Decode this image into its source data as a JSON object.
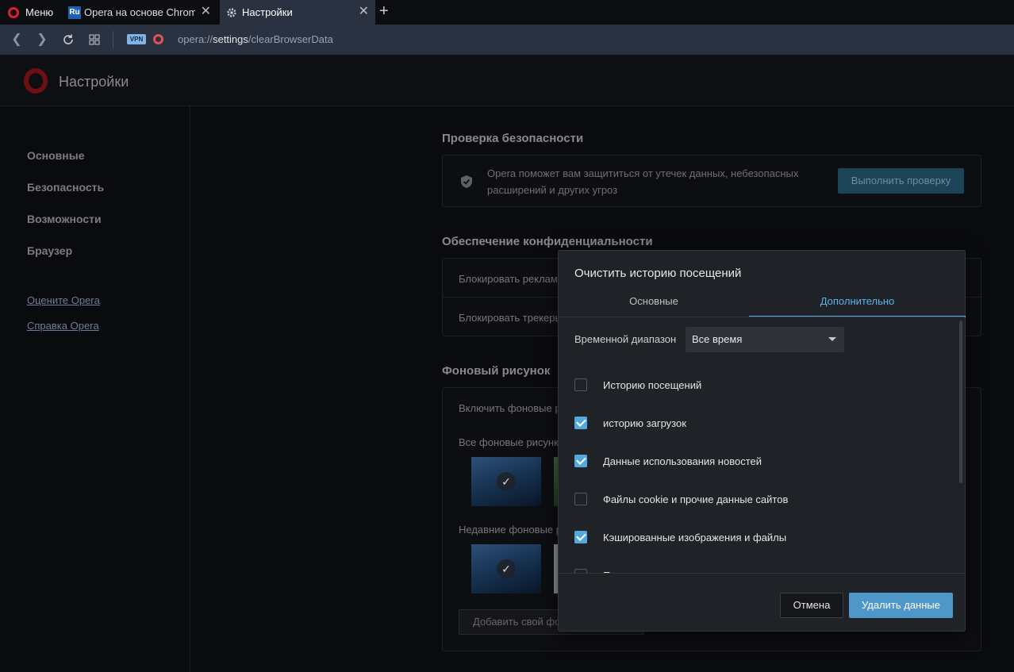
{
  "browser": {
    "menu_label": "Меню",
    "tabs": [
      {
        "label": "Opera на основе Chromium",
        "icon": "Ru"
      },
      {
        "label": "Настройки",
        "icon": "gear-icon"
      }
    ],
    "url_prefix": "opera://",
    "url_host": "settings",
    "url_path": "/clearBrowserData",
    "vpn_label": "VPN"
  },
  "header": {
    "title": "Настройки"
  },
  "sidebar": {
    "items": [
      {
        "label": "Основные"
      },
      {
        "label": "Безопасность"
      },
      {
        "label": "Возможности"
      },
      {
        "label": "Браузер"
      }
    ],
    "links": [
      {
        "label": "Оцените Opera"
      },
      {
        "label": "Справка Opera"
      }
    ]
  },
  "main": {
    "security": {
      "title": "Проверка безопасности",
      "text_line1": "Opera поможет вам защититься от утечек данных, небезопасных",
      "text_line2": "расширений и других угроз",
      "button": "Выполнить проверку"
    },
    "privacy": {
      "title": "Обеспечение конфиденциальности",
      "rows": [
        "Блокировать рекламу",
        "Блокировать трекеры"
      ]
    },
    "wallpaper": {
      "title": "Фоновый рисунок",
      "enable_label": "Включить фоновые р",
      "all_label": "Все фоновые рисунк",
      "recent_label": "Недавние фоновые р",
      "add_button": "Добавить свой фо"
    }
  },
  "dialog": {
    "title": "Очистить историю посещений",
    "tabs": [
      "Основные",
      "Дополнительно"
    ],
    "active_tab": "Дополнительно",
    "range_label": "Временной диапазон",
    "range_value": "Все время",
    "options": [
      {
        "label": "Историю посещений",
        "checked": false
      },
      {
        "label": "историю загрузок",
        "checked": true
      },
      {
        "label": "Данные использования новостей",
        "checked": true
      },
      {
        "label": "Файлы cookie и прочие данные сайтов",
        "checked": false
      },
      {
        "label": "Кэшированные изображения и файлы",
        "checked": true
      },
      {
        "label": "П",
        "checked": false
      }
    ],
    "cancel": "Отмена",
    "confirm": "Удалить данные"
  },
  "colors": {
    "accent": "#5aa6db",
    "brand_red": "#e0202a"
  }
}
